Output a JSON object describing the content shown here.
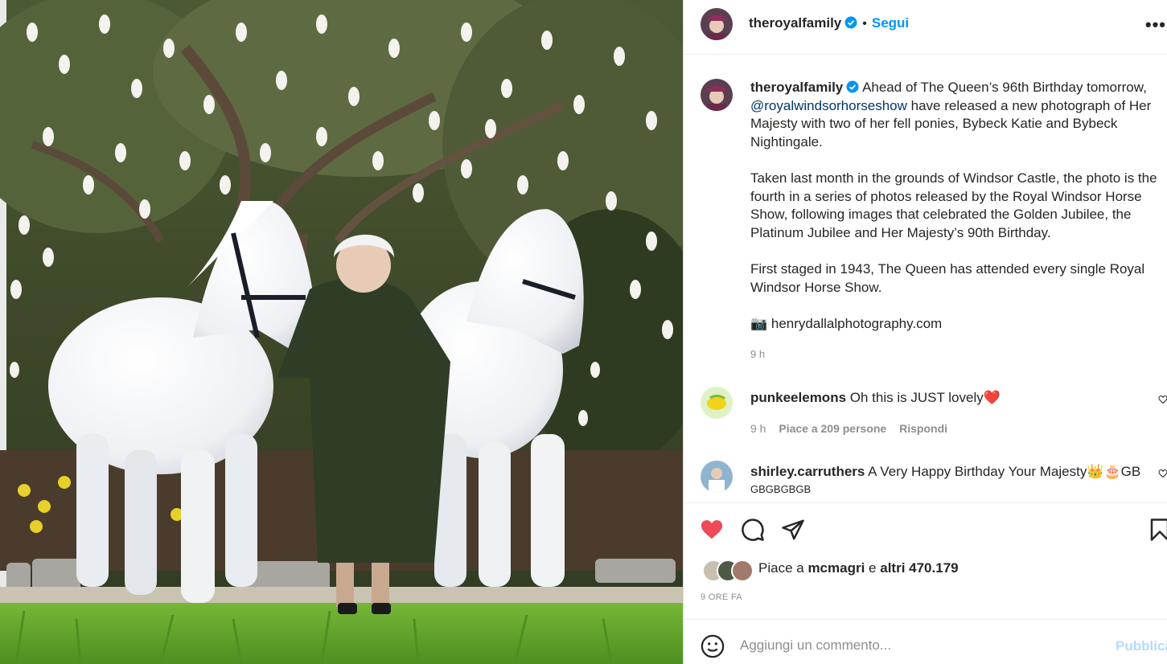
{
  "post": {
    "photo_alt": "Photo of Queen with two white fell ponies under magnolia tree",
    "username": "theroyalfamily",
    "follow_label": "Segui",
    "separator": "•",
    "more_label": "•••"
  },
  "caption": {
    "username": "theroyalfamily",
    "lines": [
      "Ahead of The Queen’s 96th Birthday tomorrow,",
      "have released a new photograph of Her",
      "Majesty with two of her fell ponies, Bybeck Katie and Bybeck",
      "Nightingale.",
      "Taken last month in the grounds of Windsor Castle, the photo is the",
      "fourth in a series of photos released by the Royal Windsor Horse",
      "Show, following images that celebrated the Golden Jubilee, the",
      "Platinum Jubilee and Her Majesty’s 90th Birthday.",
      "First staged in 1943, The Queen has attended every single Royal",
      "Windsor Horse Show.",
      "📷 henrydallalphotography.com"
    ],
    "mention": "@royalwindsorhorseshow",
    "time": "9 h"
  },
  "comments": [
    {
      "username": "punkeelemons",
      "text": "Oh this is JUST lovely❤️",
      "time": "9 h",
      "likes": "Piace a 209 persone",
      "reply": "Rispondi"
    },
    {
      "username": "shirley.carruthers",
      "text": "A Very Happy Birthday Your Majesty👑🎂GB",
      "text2": "GBGBGBGB"
    }
  ],
  "actions": {
    "like_icon": "heart-filled-icon",
    "comment_icon": "comment-icon",
    "share_icon": "share-icon",
    "save_icon": "bookmark-icon"
  },
  "likes": {
    "prefix": "Piace a",
    "user": "mcmagri",
    "middle": "e",
    "others": "altri 470.179"
  },
  "posted_ago": "9 ORE FA",
  "add_comment": {
    "placeholder": "Aggiungi un commento...",
    "publish_label": "Pubblica"
  },
  "colors": {
    "accent": "#0095f6",
    "like": "#ed4956",
    "muted": "#8e8e8e",
    "mention": "#00376b"
  }
}
